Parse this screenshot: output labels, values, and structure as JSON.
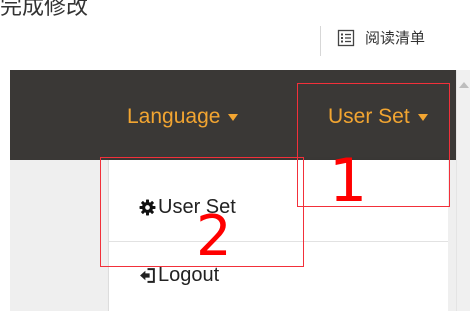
{
  "top_fragment": "完成修改",
  "toolbar": {
    "reading_list_label": "阅读清单",
    "reading_list_icon": "list-icon"
  },
  "navbar": {
    "background": "#3a3836",
    "accent": "#f2a531",
    "items": [
      {
        "label": "Language",
        "icon": "caret-down-icon"
      },
      {
        "label": "User Set",
        "icon": "caret-down-icon"
      }
    ]
  },
  "dropdown": {
    "items": [
      {
        "label": "User Set",
        "icon": "gear-icon"
      },
      {
        "label": "Logout",
        "icon": "logout-icon"
      }
    ]
  },
  "annotations": {
    "color": "#ff0000",
    "labels": [
      "1",
      "2"
    ]
  }
}
